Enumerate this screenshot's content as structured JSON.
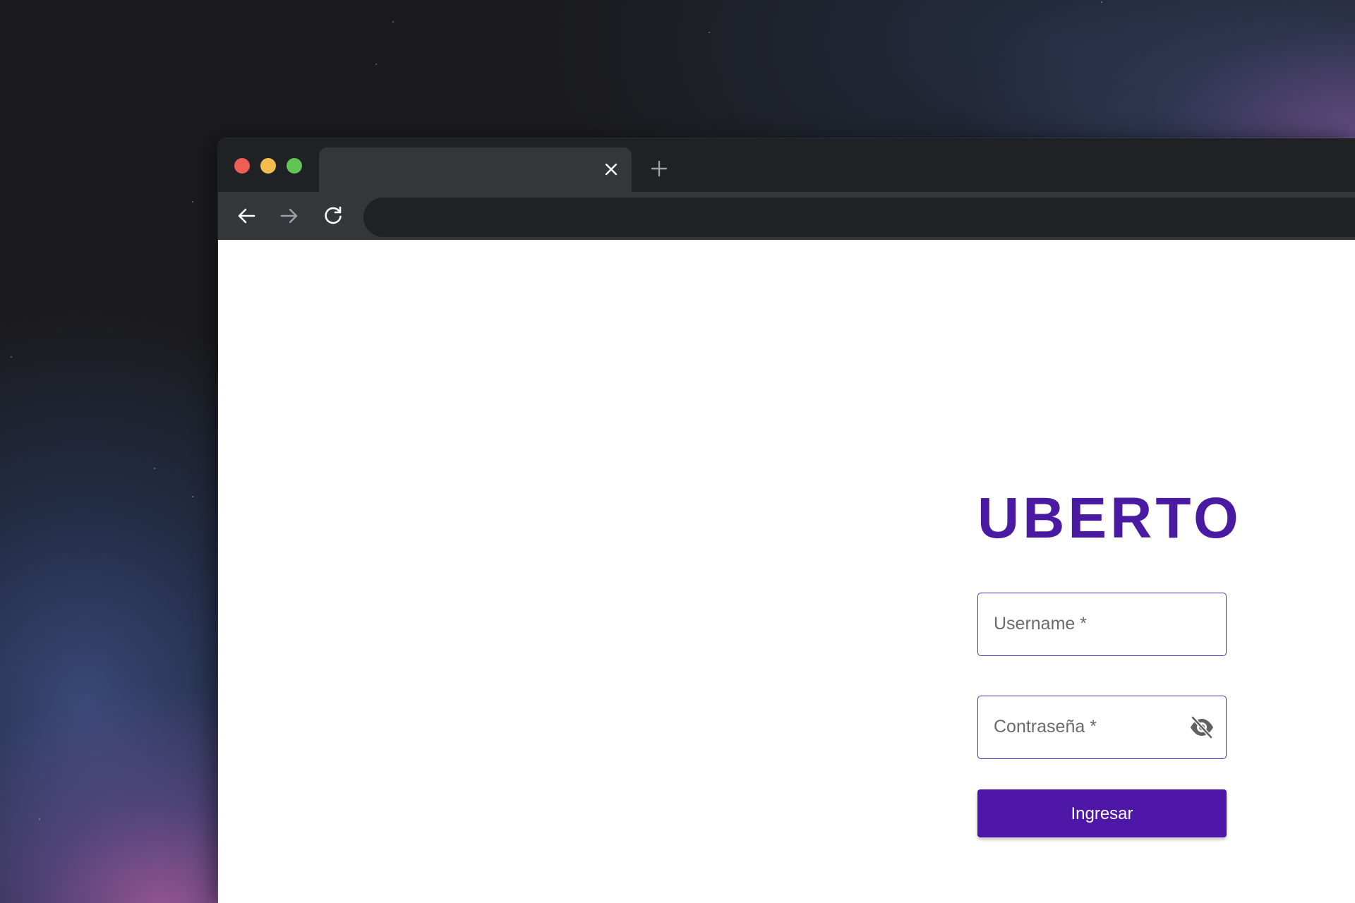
{
  "browser": {
    "tab": {
      "title": "",
      "close_icon": "close-icon"
    },
    "new_tab_icon": "plus-icon",
    "toolbar": {
      "back_icon": "arrow-left-icon",
      "forward_icon": "arrow-right-icon",
      "reload_icon": "reload-icon",
      "address": ""
    },
    "colors": {
      "tab_strip": "#202124",
      "toolbar": "#35363a",
      "traffic_red": "#ed5f56",
      "traffic_yellow": "#f4bd4f",
      "traffic_green": "#61c554"
    }
  },
  "login": {
    "brand": "UBERTO",
    "username": {
      "label": "Username *",
      "value": ""
    },
    "password": {
      "label": "Contraseña *",
      "value": "",
      "toggle_icon": "eye-off-icon"
    },
    "submit_label": "Ingresar",
    "colors": {
      "brand": "#4b1aa3",
      "field_border": "#5b2bb5",
      "button": "#4f17a8",
      "button_text": "#ffffff"
    }
  }
}
